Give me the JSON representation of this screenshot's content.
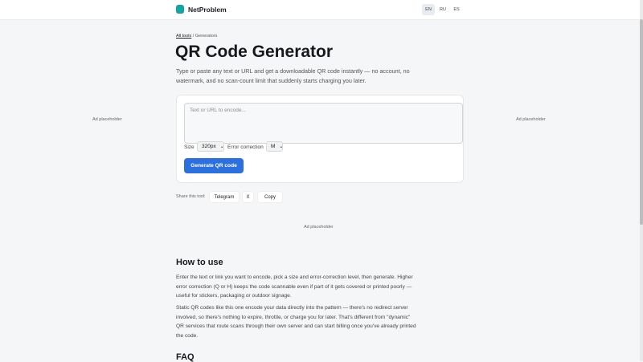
{
  "header": {
    "brand": "NetProblem",
    "languages": [
      "EN",
      "RU",
      "ES"
    ],
    "active_language": "EN"
  },
  "breadcrumb": {
    "root": "All tools",
    "separator": "/",
    "current": "Generators"
  },
  "page": {
    "title": "QR Code Generator",
    "intro": "Type or paste any text or URL and get a downloadable QR code instantly — no account, no watermark, and no scan-count limit that suddenly starts charging you later."
  },
  "form": {
    "input_placeholder": "Text or URL to encode...",
    "input_value": "",
    "size_label": "Size",
    "size_value": "320px",
    "ec_label": "Error correction",
    "ec_value": "M",
    "generate_label": "Generate QR code"
  },
  "share": {
    "label": "Share this tool:",
    "telegram": "Telegram",
    "x": "X",
    "copy": "Copy"
  },
  "ads": {
    "left": "Ad placeholder",
    "right": "Ad placeholder",
    "center": "Ad placeholder"
  },
  "how_to": {
    "title": "How to use",
    "p1": "Enter the text or link you want to encode, pick a size and error-correction level, then generate. Higher error correction (Q or H) keeps the code scannable even if part of it gets covered or printed poorly — useful for stickers, packaging or outdoor signage.",
    "p2": "Static QR codes like this one encode your data directly into the pattern — there's no redirect server involved, so there's nothing to expire, throttle, or charge you for later. That's different from \"dynamic\" QR services that route scans through their own server and can start billing once you've already printed the code."
  },
  "faq": {
    "title": "FAQ"
  },
  "colors": {
    "accent": "#2d6fdb",
    "brand": "#17a3a0",
    "background": "#f5f6f7"
  }
}
